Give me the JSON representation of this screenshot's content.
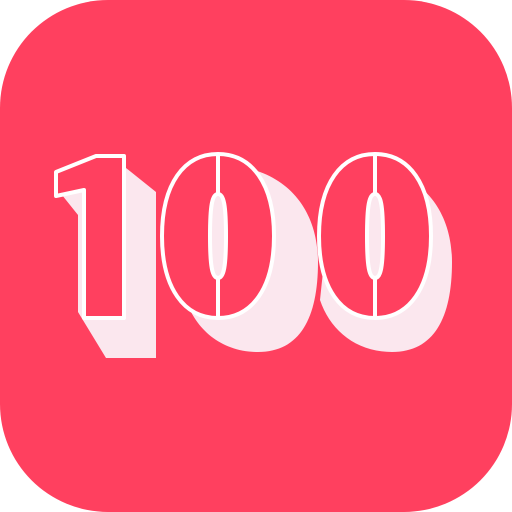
{
  "badge": {
    "number_text": "100",
    "tile_color": "#ff405f",
    "digit_fill": "#ffffff",
    "digit_outline": "#ffffff",
    "shadow_color": "#fbe7ee",
    "icon": "hundred-icon"
  }
}
